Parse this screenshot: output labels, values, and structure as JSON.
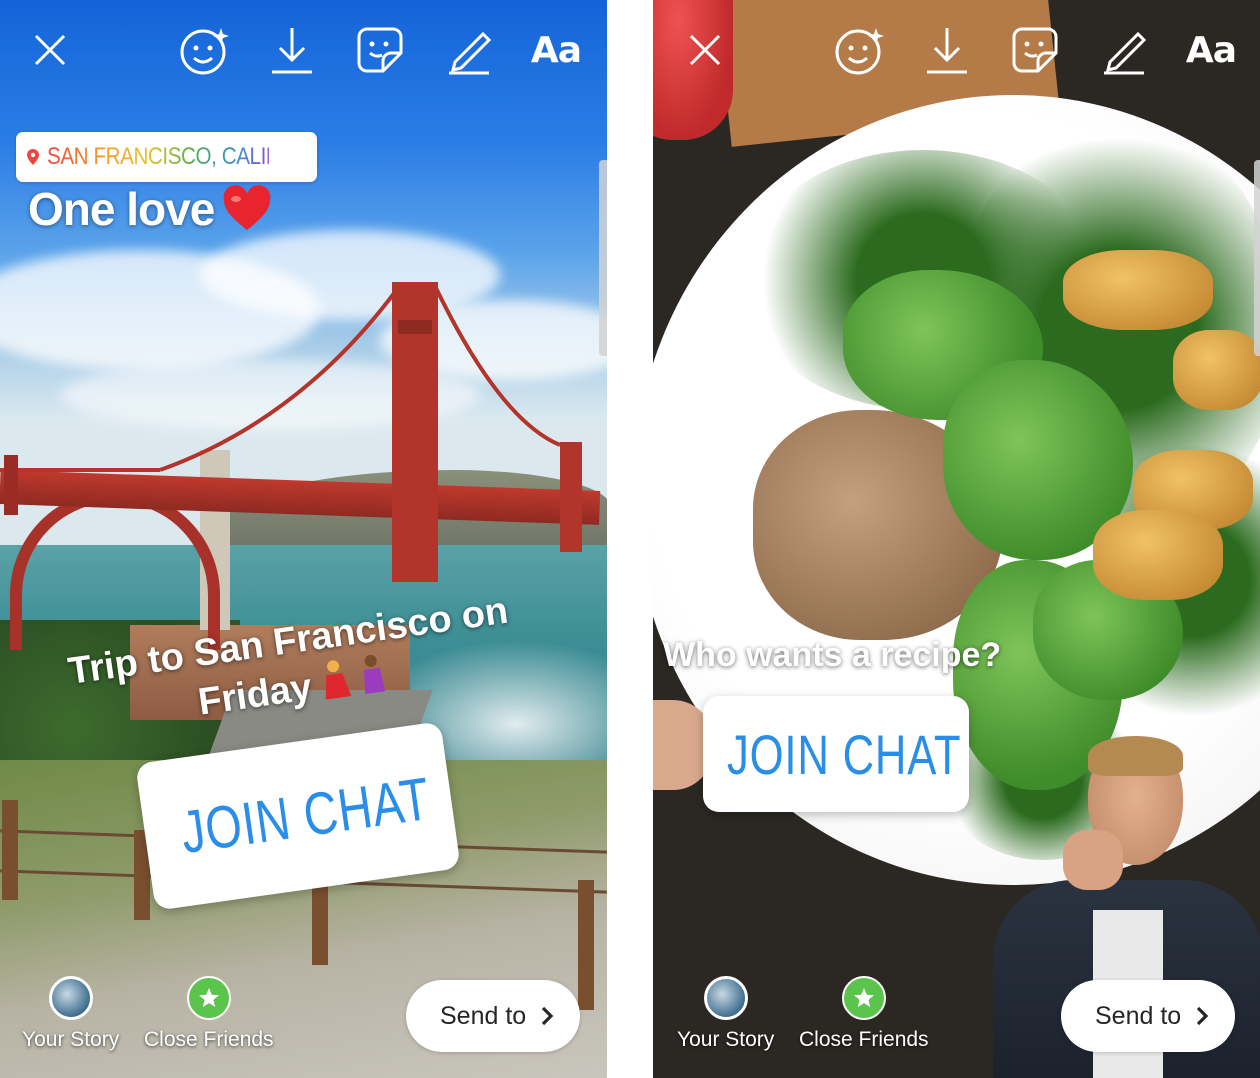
{
  "colors": {
    "accent_blue": "#2a8ee8",
    "close_friends_green": "#5ac44d",
    "white": "#ffffff"
  },
  "toolbar": {
    "icons": [
      "close-icon",
      "face-filter-icon",
      "download-icon",
      "sticker-icon",
      "draw-icon",
      "text-icon"
    ],
    "text_tool_label": "Aa"
  },
  "left_story": {
    "location_sticker": "SAN FRANCISCO, CALIFORNIA",
    "caption": "One love",
    "trip_caption_line1": "Trip to San Francisco on",
    "trip_caption_line2": "Friday",
    "join_chat": "JOIN CHAT"
  },
  "right_story": {
    "caption": "Who wants a recipe?",
    "join_chat": "JOIN CHAT"
  },
  "bottom_bar": {
    "your_story": "Your Story",
    "close_friends": "Close Friends",
    "send_to": "Send to"
  }
}
